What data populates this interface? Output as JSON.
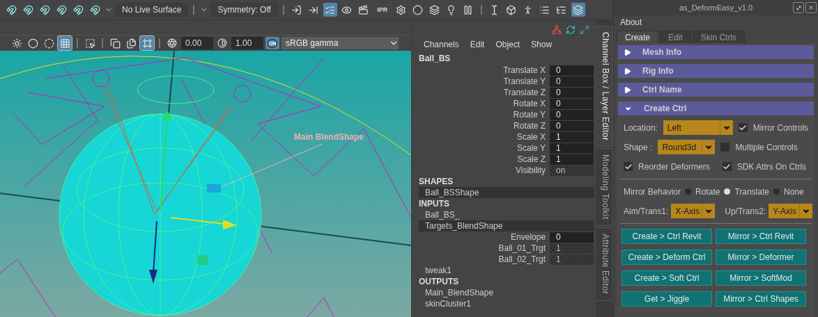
{
  "toolbar": {
    "live_surface": "No Live Surface",
    "symmetry": "Symmetry: Off",
    "buttons": [
      {
        "kind": "import",
        "selected": false
      },
      {
        "kind": "export",
        "selected": false
      },
      {
        "kind": "history",
        "selected": true
      },
      {
        "kind": "render-view",
        "selected": false
      },
      {
        "kind": "render",
        "selected": false
      },
      {
        "kind": "ipr",
        "selected": false,
        "label": "IPR"
      },
      {
        "kind": "render-settings",
        "selected": false
      },
      {
        "kind": "hypershade",
        "selected": false
      },
      {
        "kind": "render-setup",
        "selected": false
      },
      {
        "kind": "light",
        "selected": false
      },
      {
        "kind": "pause",
        "selected": false
      },
      {
        "kind": "sep"
      },
      {
        "kind": "text-select",
        "selected": false
      },
      {
        "kind": "cube",
        "selected": false
      },
      {
        "kind": "figure",
        "selected": false
      },
      {
        "kind": "list",
        "selected": false
      },
      {
        "kind": "list2",
        "selected": false
      },
      {
        "kind": "layers",
        "selected": true
      }
    ]
  },
  "viewport": {
    "tools": [
      {
        "kind": "sphere",
        "selected": false
      },
      {
        "kind": "sphere2",
        "selected": false
      },
      {
        "kind": "ring",
        "selected": false
      },
      {
        "kind": "grid",
        "selected": true
      },
      {
        "kind": "sep"
      },
      {
        "kind": "select",
        "selected": false
      },
      {
        "kind": "sep"
      },
      {
        "kind": "copy",
        "selected": false
      },
      {
        "kind": "copy2",
        "selected": false
      },
      {
        "kind": "frame",
        "selected": true
      }
    ],
    "exposure": "0.00",
    "gamma": "1.00",
    "color_management": {
      "label": "ON",
      "on": true
    },
    "color_space": "sRGB gamma",
    "annotation": "Main BlendShape"
  },
  "channel_box": {
    "menu": [
      "Channels",
      "Edit",
      "Object",
      "Show"
    ],
    "rows": [
      {
        "kind": "object",
        "text": "Ball_BS"
      },
      {
        "kind": "attr",
        "label": "Translate X",
        "value": "0",
        "keyable": true
      },
      {
        "kind": "attr",
        "label": "Translate Y",
        "value": "0",
        "keyable": true
      },
      {
        "kind": "attr",
        "label": "Translate Z",
        "value": "0",
        "keyable": true
      },
      {
        "kind": "attr",
        "label": "Rotate X",
        "value": "0",
        "keyable": true
      },
      {
        "kind": "attr",
        "label": "Rotate Y",
        "value": "0",
        "keyable": true
      },
      {
        "kind": "attr",
        "label": "Rotate Z",
        "value": "0",
        "keyable": true
      },
      {
        "kind": "attr",
        "label": "Scale X",
        "value": "1",
        "keyable": true
      },
      {
        "kind": "attr",
        "label": "Scale Y",
        "value": "1",
        "keyable": true
      },
      {
        "kind": "attr",
        "label": "Scale Z",
        "value": "1",
        "keyable": true
      },
      {
        "kind": "attr",
        "label": "Visibility",
        "value": "on",
        "keyable": false
      },
      {
        "kind": "section",
        "text": "SHAPES"
      },
      {
        "kind": "node",
        "text": "Ball_BSShape",
        "selected": true
      },
      {
        "kind": "section",
        "text": "INPUTS"
      },
      {
        "kind": "node",
        "text": "Ball_BS_",
        "selected": false
      },
      {
        "kind": "node",
        "text": "Targets_BlendShape",
        "selected": true
      },
      {
        "kind": "attr",
        "label": "Envelope",
        "value": "0",
        "keyable": true
      },
      {
        "kind": "attr",
        "label": "Ball_01_Trgt",
        "value": "1",
        "keyable": false
      },
      {
        "kind": "attr",
        "label": "Ball_02_Trgt",
        "value": "1",
        "keyable": false
      },
      {
        "kind": "node",
        "text": "tweak1",
        "selected": false
      },
      {
        "kind": "section",
        "text": "OUTPUTS"
      },
      {
        "kind": "node",
        "text": "Main_BlendShape",
        "selected": false
      },
      {
        "kind": "node",
        "text": "skinCluster1",
        "selected": false
      }
    ]
  },
  "side_tabs": [
    {
      "label": "Channel Box / Layer Editor",
      "selected": true
    },
    {
      "label": "Modeling Toolkit",
      "selected": false
    },
    {
      "label": "Attribute Editor",
      "selected": false
    }
  ],
  "tool_window": {
    "title": "as_DeformEasy_v1.0",
    "menu": [
      "About"
    ],
    "tabs": [
      {
        "label": "Create",
        "selected": true
      },
      {
        "label": "Edit",
        "selected": false
      },
      {
        "label": "Skin Ctrls",
        "selected": false
      }
    ],
    "sections": [
      {
        "title": "Mesh Info",
        "expanded": false
      },
      {
        "title": "Rig Info",
        "expanded": false
      },
      {
        "title": "Ctrl Name",
        "expanded": false
      },
      {
        "title": "Create Ctrl",
        "expanded": true
      }
    ],
    "location": {
      "label": "Location:",
      "value": "Left"
    },
    "mirror_controls": {
      "label": "Mirror Controls",
      "checked": true
    },
    "shape": {
      "label": "Shape :",
      "value": "Round3d"
    },
    "multiple_controls": {
      "label": "Multiple Controls",
      "checked": false
    },
    "reorder_deformers": {
      "label": "Reorder Deformers",
      "checked": true
    },
    "sdk_attrs": {
      "label": "SDK Attrs On Ctrls",
      "checked": true
    },
    "mirror_behavior": {
      "label": "Mirror Behavior",
      "options": [
        {
          "label": "Rotate",
          "selected": false
        },
        {
          "label": "Translate",
          "selected": true
        },
        {
          "label": "None",
          "selected": false
        }
      ]
    },
    "aim": {
      "label": "Aim/Trans1:",
      "value": "X-Axis"
    },
    "up": {
      "label": "Up/Trans2:",
      "value": "Y-Axis"
    },
    "buttons": [
      "Create > Ctrl Revit",
      "Mirror > Ctrl Revit",
      "Create > Deform Ctrl",
      "Mirror > Deformer",
      "Create > Soft Ctrl",
      "Mirror > SoftMod",
      "Get > Jiggle",
      "Mirror > Ctrl Shapes"
    ]
  }
}
